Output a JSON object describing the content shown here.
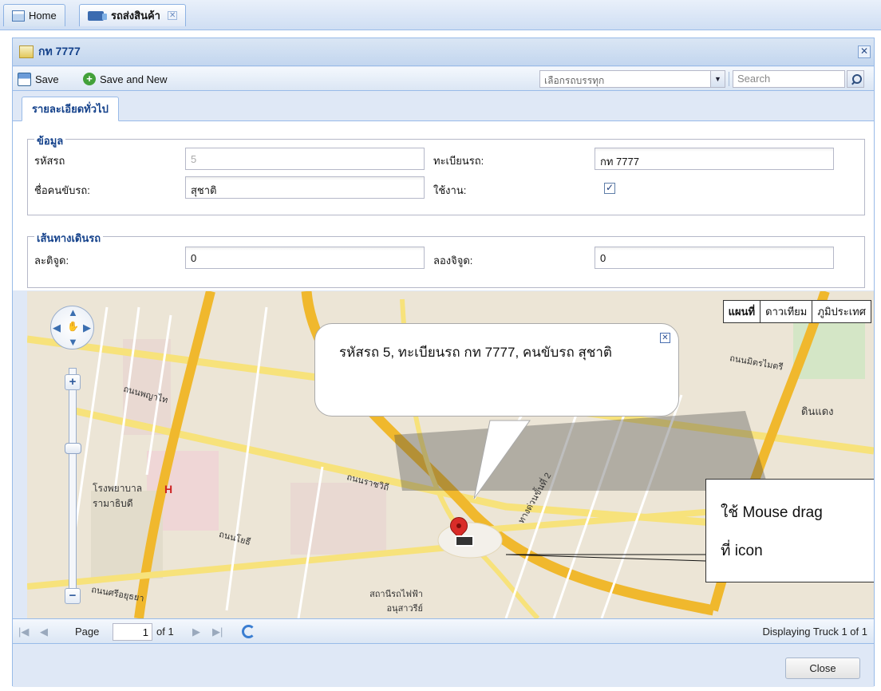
{
  "tabs": [
    {
      "label": "Home",
      "icon": "home-icon"
    },
    {
      "label": "รถส่งสินค้า",
      "icon": "truck-icon",
      "active": true
    }
  ],
  "window": {
    "title": "กท 7777"
  },
  "toolbar": {
    "save_label": "Save",
    "save_new_label": "Save and New",
    "combo_value": "เลือกรถบรรทุก",
    "search_placeholder": "Search"
  },
  "form_tab": "รายละเอียดทั่วไป",
  "info": {
    "legend": "ข้อมูล",
    "car_id_label": "รหัสรถ",
    "car_id_value": "5",
    "plate_label": "ทะเบียนรถ:",
    "plate_value": "กท 7777",
    "driver_label": "ชื่อคนขับรถ:",
    "driver_value": "สุชาติ",
    "active_label": "ใช้งาน:",
    "active_checked": true
  },
  "route": {
    "legend": "เส้นทางเดินรถ",
    "lat_label": "ละติจูด:",
    "lat_value": "0",
    "lng_label": "ลองจิจูด:",
    "lng_value": "0"
  },
  "map": {
    "types": [
      "แผนที่",
      "ดาวเทียม",
      "ภูมิประเทศ"
    ],
    "popup_text": "รหัสรถ 5, ทะเบียนรถ กท 7777, คนขับรถ สุชาติ",
    "callout_line1": "ใช้ Mouse drag",
    "callout_line2": "ที่ icon",
    "labels": [
      "ถนนราชวิถี",
      "ดินแดง",
      "โรงพยาบาล รามาธิบดี",
      "H",
      "สถานีรถไฟฟ้า อนุสาวรีย์ ชัยสมรภูมิ",
      "ถนนพญาไท",
      "ถนนโยธี",
      "ถนนศรีอยุธยา",
      "ถนนมิตรไมตรี",
      "ทางด่วนขั้นที่ 2"
    ]
  },
  "pager": {
    "page_label": "Page",
    "page_value": "1",
    "of_label": "of 1",
    "display_text": "Displaying Truck 1 of 1"
  },
  "footer": {
    "close_label": "Close"
  },
  "colors": {
    "accent": "#15428b",
    "frame": "#99bbe8",
    "pin": "#d92c28"
  }
}
